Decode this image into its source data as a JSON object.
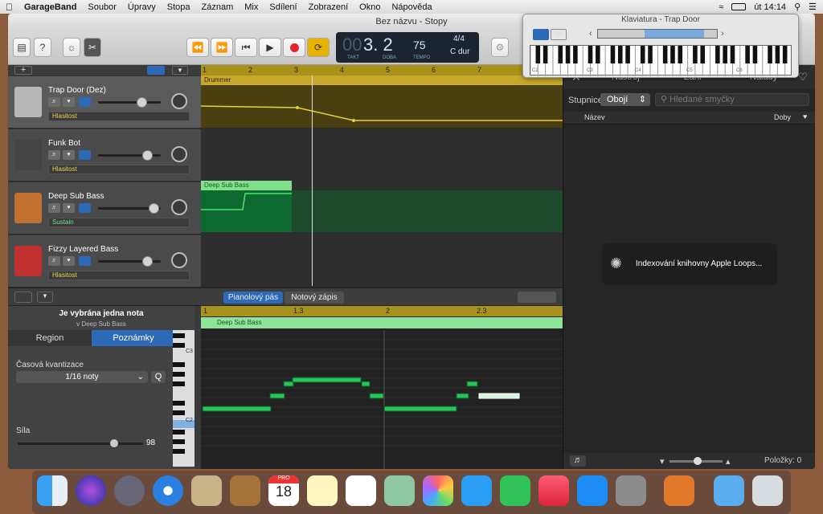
{
  "menubar": {
    "apple": "",
    "app": "GarageBand",
    "items": [
      "Soubor",
      "Úpravy",
      "Stopa",
      "Záznam",
      "Mix",
      "Sdílení",
      "Zobrazení",
      "Okno",
      "Nápověda"
    ],
    "clock": "út 14:14"
  },
  "window": {
    "title": "Bez názvu - Stopy"
  },
  "lcd": {
    "bar_value": "00",
    "beat_value": "3. 2",
    "bar_label": "TAKT",
    "beat_label": "DOBA",
    "tempo": "75",
    "tempo_label": "TEMPO",
    "signature": "4/4",
    "key": "C dur"
  },
  "keyboard_window": {
    "title": "Klaviatura - Trap Door",
    "octave_labels": [
      "C2",
      "C3",
      "C4",
      "C5",
      "C6"
    ]
  },
  "ruler": {
    "marks": [
      "1",
      "2",
      "3",
      "4",
      "5",
      "6",
      "7"
    ]
  },
  "tracks": [
    {
      "name": "Trap Door (Dez)",
      "param": "Hlasitost",
      "param_color": "yellow"
    },
    {
      "name": "Funk Bot",
      "param": "Hlasitost",
      "param_color": "yellow"
    },
    {
      "name": "Deep Sub Bass",
      "param": "Sustain",
      "param_color": "green"
    },
    {
      "name": "Fizzy Layered Bass",
      "param": "Hlasitost",
      "param_color": "yellow"
    }
  ],
  "regions": {
    "drummer": "Drummer",
    "deep_sub_bass": "Deep Sub Bass"
  },
  "editor": {
    "tab_piano": "Pianolový pás",
    "tab_score": "Notový zápis",
    "selection_title": "Je vybrána jedna nota",
    "selection_sub": "v Deep Sub Bass",
    "tab_region": "Region",
    "tab_notes": "Poznámky",
    "quantize_label": "Časová kvantizace",
    "quantize_value": "1/16 noty",
    "quantize_button": "Q",
    "velocity_label": "Síla",
    "velocity_value": "98",
    "velocity_level": 0.77,
    "ruler_marks": [
      "1",
      "1.3",
      "2",
      "2.3"
    ],
    "region_name": "Deep Sub Bass",
    "key_labels": [
      "C3",
      "C2"
    ]
  },
  "library": {
    "tabs": [
      "Nástroj",
      "Žánr",
      "Nálady"
    ],
    "scale_label": "Stupnice:",
    "scale_value": "Obojí",
    "search_placeholder": "Hledané smyčky",
    "col_name": "Název",
    "col_beats": "Doby",
    "indexing": "Indexování knihovny Apple Loops...",
    "items_label": "Položky: 0"
  },
  "dock": {
    "calendar_month": "PRO",
    "calendar_day": "18"
  }
}
